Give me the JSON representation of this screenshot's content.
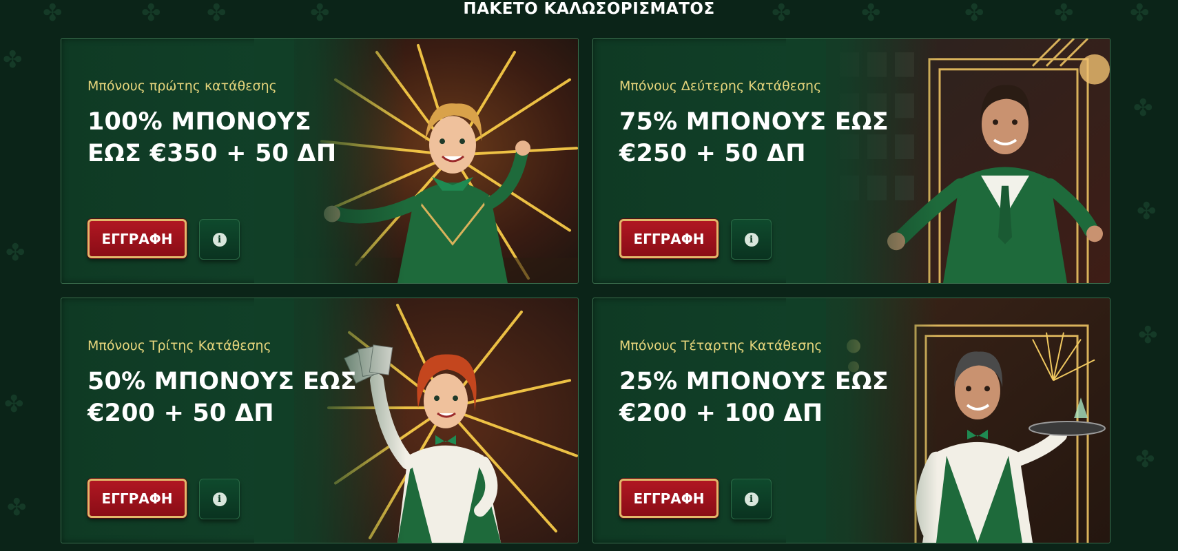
{
  "section": {
    "title": "ΠΑΚΕΤΟ ΚΑΛΩΣΟΡΙΣΜΑΤΟΣ"
  },
  "colors": {
    "background": "#0b2418",
    "card": "#114028",
    "accent_gold": "#e6d57c",
    "button_red": "#9e111b",
    "button_info": "#0d3f27"
  },
  "cards": [
    {
      "subtitle": "Μπόνους πρώτης κατάθεσης",
      "title": "100% ΜΠΟΝΟΥΣ ΕΩΣ €350 + 50 ΔΠ",
      "signup_label": "ΕΓΓΡΑΦΗ",
      "info_icon": "info-icon",
      "image": "female-concierge-illustration"
    },
    {
      "subtitle": "Μπόνους Δεύτερης Κατάθεσης",
      "title": "75% ΜΠΟΝΟΥΣ ΕΩΣ €250 + 50 ΔΠ",
      "signup_label": "ΕΓΓΡΑΦΗ",
      "info_icon": "info-icon",
      "image": "male-concierge-illustration"
    },
    {
      "subtitle": "Μπόνους Τρίτης Κατάθεσης",
      "title": "50% ΜΠΟΝΟΥΣ ΕΩΣ €200 + 50 ΔΠ",
      "signup_label": "ΕΓΓΡΑΦΗ",
      "info_icon": "info-icon",
      "image": "female-dealer-illustration"
    },
    {
      "subtitle": "Μπόνους Τέταρτης Κατάθεσης",
      "title": "25% ΜΠΟΝΟΥΣ ΕΩΣ €200 + 100 ΔΠ",
      "signup_label": "ΕΓΓΡΑΦΗ",
      "info_icon": "info-icon",
      "image": "male-waiter-illustration"
    }
  ]
}
